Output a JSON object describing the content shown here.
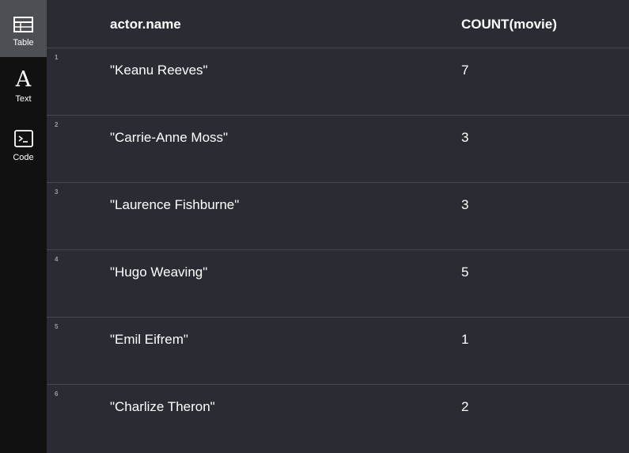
{
  "sidebar": {
    "views": [
      {
        "label": "Table",
        "icon": "table-icon",
        "active": true
      },
      {
        "label": "Text",
        "icon": "text-icon",
        "glyph": "A",
        "active": false
      },
      {
        "label": "Code",
        "icon": "code-icon",
        "active": false
      }
    ]
  },
  "table": {
    "columns": [
      "actor.name",
      "COUNT(movie)"
    ],
    "rows": [
      {
        "index": "1",
        "name": "\"Keanu Reeves\"",
        "count": "7"
      },
      {
        "index": "2",
        "name": "\"Carrie-Anne Moss\"",
        "count": "3"
      },
      {
        "index": "3",
        "name": "\"Laurence Fishburne\"",
        "count": "3"
      },
      {
        "index": "4",
        "name": "\"Hugo Weaving\"",
        "count": "5"
      },
      {
        "index": "5",
        "name": "\"Emil Eifrem\"",
        "count": "1"
      },
      {
        "index": "6",
        "name": "\"Charlize Theron\"",
        "count": "2"
      }
    ]
  },
  "colors": {
    "sidebar_bg": "#111111",
    "active_view_bg": "#4d4f55",
    "main_bg": "#292c33",
    "row_divider": "#45484f",
    "text": "#ffffff",
    "row_index": "#9a9ca3"
  }
}
